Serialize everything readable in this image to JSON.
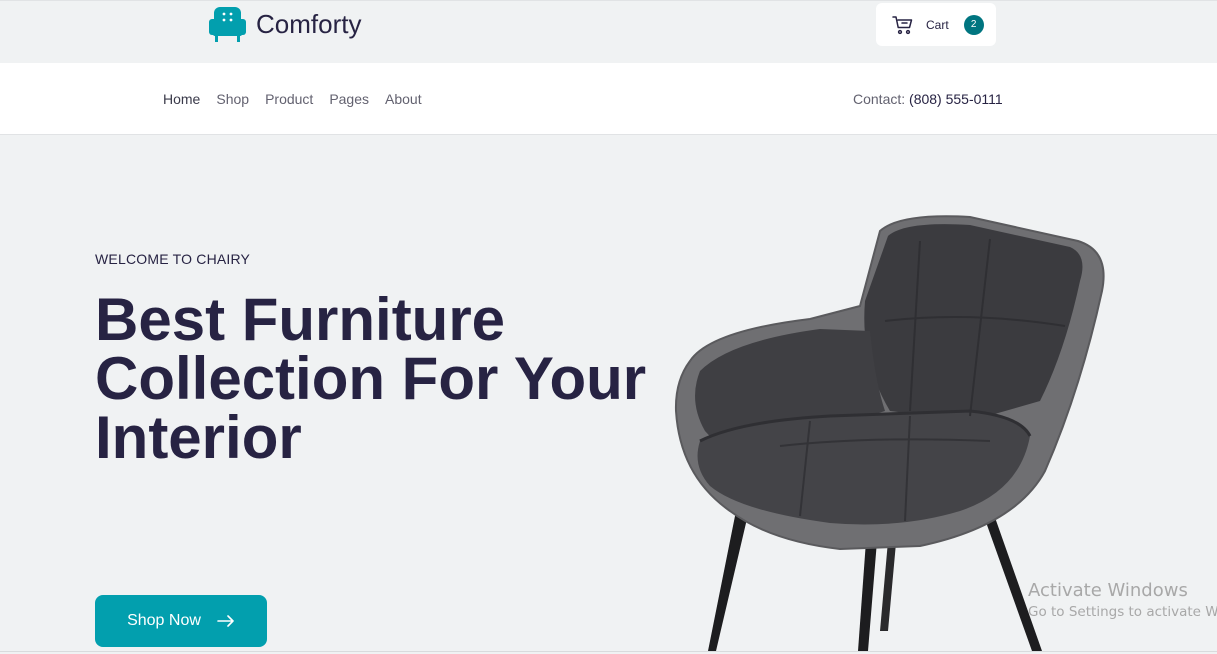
{
  "brand": {
    "name": "Comforty",
    "logo_icon": "armchair-icon",
    "accent": "#029fae"
  },
  "cart": {
    "label": "Cart",
    "count": "2",
    "icon": "cart-icon",
    "badge_color": "#007580"
  },
  "nav": {
    "items": [
      {
        "label": "Home"
      },
      {
        "label": "Shop"
      },
      {
        "label": "Product"
      },
      {
        "label": "Pages"
      },
      {
        "label": "About"
      }
    ],
    "contact_label": "Contact:",
    "contact_phone": "(808) 555-0111"
  },
  "hero": {
    "eyebrow": "WELCOME TO CHAIRY",
    "headline_lines": [
      "Best Furniture",
      "Collection For Your",
      "Interior"
    ],
    "cta_label": "Shop Now",
    "cta_icon": "arrow-right-icon",
    "image": "grey-armchair"
  },
  "watermark": {
    "title": "Activate Windows",
    "subtitle": "Go to Settings to activate Windows."
  }
}
